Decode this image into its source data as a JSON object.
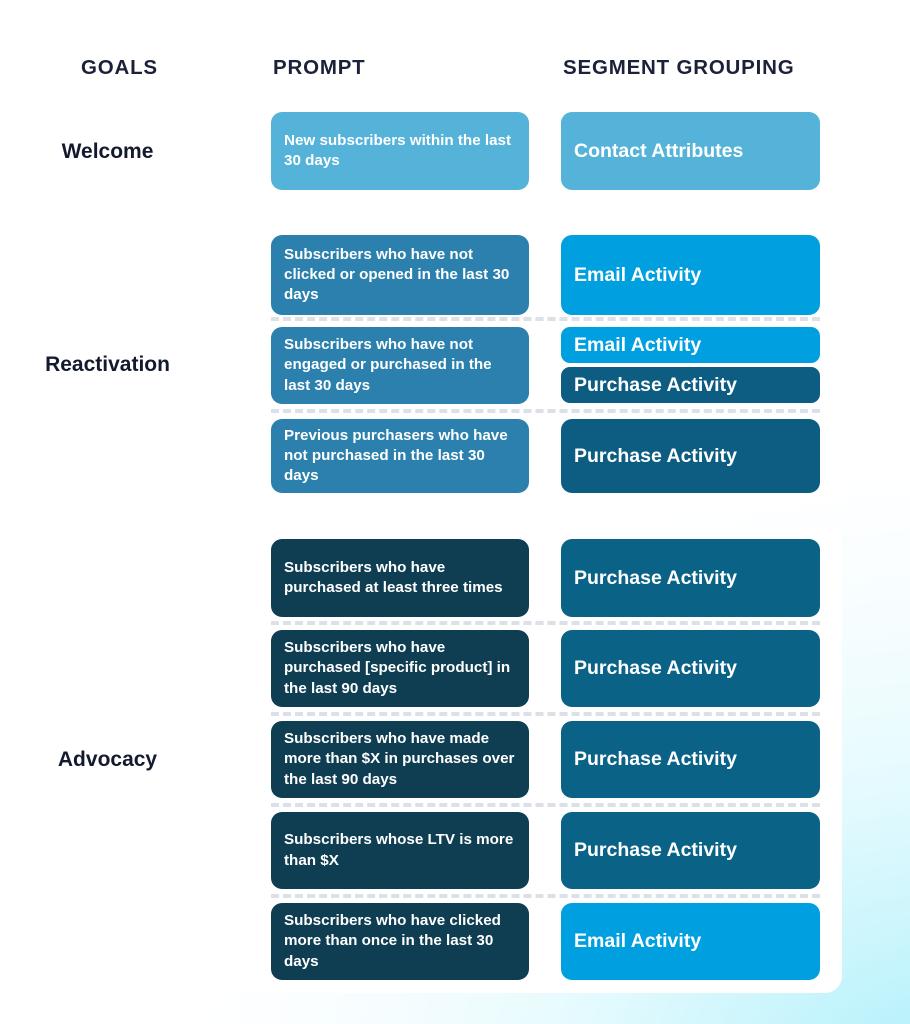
{
  "palette": {
    "bg_light": "#ffffff",
    "bg_cyan": "#b3f0fc",
    "panel": "#ffffff",
    "heading_text": "#1b2139",
    "goal_text": "#141a2e",
    "prompt_welcome": "#55b3d9",
    "prompt_reactivation": "#2b80ad",
    "prompt_advocacy": "#0f3e52",
    "segment_contact_attributes": "#55b3d9",
    "segment_email_activity": "#00a0e0",
    "segment_purchase_activity_mid": "#0d5d82",
    "segment_purchase_activity_dark": "#0a6287",
    "separator": "#dbe1e7",
    "card_text": "#ffffff"
  },
  "headers": {
    "goals": "GOALS",
    "prompt": "PROMPT",
    "segment_grouping": "SEGMENT GROUPING"
  },
  "sections": [
    {
      "goal": "Welcome",
      "rows": [
        {
          "prompt": "New subscribers within the last 30 days",
          "prompt_color": "#55b3d9",
          "segments": [
            {
              "label": "Contact Attributes",
              "color": "#55b3d9"
            }
          ]
        }
      ]
    },
    {
      "goal": "Reactivation",
      "rows": [
        {
          "prompt": "Subscribers who have not clicked or opened in the last 30 days",
          "prompt_color": "#2b80ad",
          "segments": [
            {
              "label": "Email Activity",
              "color": "#00a0e0"
            }
          ]
        },
        {
          "prompt": "Subscribers who have not engaged or purchased in the last 30 days",
          "prompt_color": "#2b80ad",
          "segments": [
            {
              "label": "Email Activity",
              "color": "#00a0e0"
            },
            {
              "label": "Purchase Activity",
              "color": "#0d5d82"
            }
          ]
        },
        {
          "prompt": "Previous purchasers who have not purchased in the last 30 days",
          "prompt_color": "#2b80ad",
          "segments": [
            {
              "label": "Purchase Activity",
              "color": "#0d5d82"
            }
          ]
        }
      ]
    },
    {
      "goal": "Advocacy",
      "rows": [
        {
          "prompt": "Subscribers who have purchased at least three times",
          "prompt_color": "#0f3e52",
          "segments": [
            {
              "label": "Purchase Activity",
              "color": "#0a6287"
            }
          ]
        },
        {
          "prompt": "Subscribers who have purchased [specific product] in the last 90 days",
          "prompt_color": "#0f3e52",
          "segments": [
            {
              "label": "Purchase Activity",
              "color": "#0a6287"
            }
          ]
        },
        {
          "prompt": "Subscribers who have made more than $X in purchases over the last 90 days",
          "prompt_color": "#0f3e52",
          "segments": [
            {
              "label": "Purchase Activity",
              "color": "#0a6287"
            }
          ]
        },
        {
          "prompt": "Subscribers whose LTV is more than $X",
          "prompt_color": "#0f3e52",
          "segments": [
            {
              "label": "Purchase Activity",
              "color": "#0a6287"
            }
          ]
        },
        {
          "prompt": "Subscribers who have clicked more than once in the last 30 days",
          "prompt_color": "#0f3e52",
          "segments": [
            {
              "label": "Email Activity",
              "color": "#00a0e0"
            }
          ]
        }
      ]
    }
  ]
}
